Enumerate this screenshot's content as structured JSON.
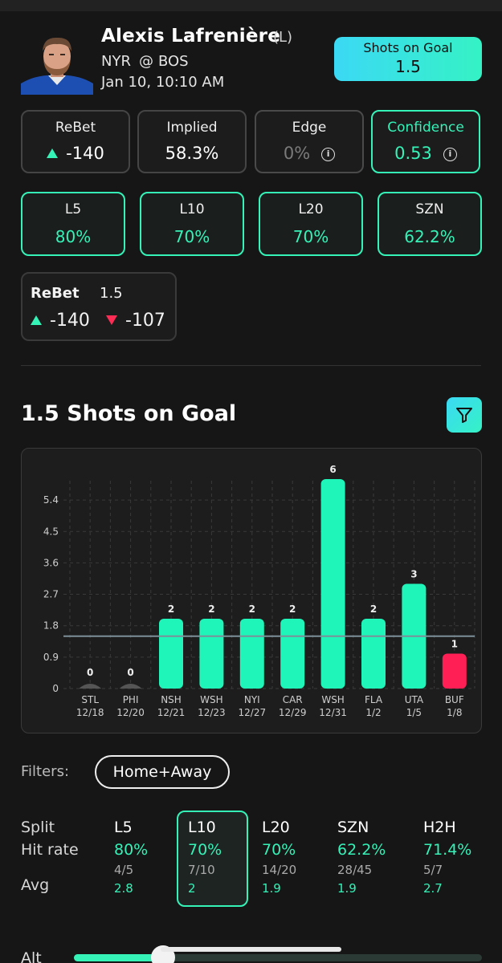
{
  "player": {
    "name": "Alexis Lafrenière",
    "position": "(L)",
    "team": "NYR",
    "at": "@",
    "opponent": "BOS",
    "datetime": "Jan 10, 10:10 AM"
  },
  "prop": {
    "label": "Shots on Goal",
    "line": "1.5"
  },
  "stats": {
    "rebet": {
      "title": "ReBet",
      "value": "-140"
    },
    "implied": {
      "title": "Implied",
      "value": "58.3%"
    },
    "edge": {
      "title": "Edge",
      "value": "0%"
    },
    "confidence": {
      "title": "Confidence",
      "value": "0.53"
    }
  },
  "hit_boxes": [
    {
      "title": "L5",
      "value": "80%"
    },
    {
      "title": "L10",
      "value": "70%"
    },
    {
      "title": "L20",
      "value": "70%"
    },
    {
      "title": "SZN",
      "value": "62.2%"
    }
  ],
  "odds": {
    "book": "ReBet",
    "line": "1.5",
    "over": "-140",
    "under": "-107"
  },
  "section": {
    "title": "1.5 Shots on Goal"
  },
  "chart_data": {
    "type": "bar",
    "categories": [
      "STL",
      "PHI",
      "NSH",
      "WSH",
      "NYI",
      "CAR",
      "WSH",
      "FLA",
      "UTA",
      "BUF"
    ],
    "dates": [
      "12/18",
      "12/20",
      "12/21",
      "12/23",
      "12/27",
      "12/29",
      "12/31",
      "1/2",
      "1/5",
      "1/8"
    ],
    "values": [
      0,
      0,
      2,
      2,
      2,
      2,
      6,
      2,
      3,
      1
    ],
    "yticks": [
      0,
      0.9,
      1.8,
      2.7,
      3.6,
      4.5,
      5.4
    ],
    "ylim": [
      0,
      6
    ],
    "reference_line": 1.5,
    "colors": {
      "hit": "#1ff5b8",
      "miss": "#ff1f55",
      "zero": "#555555"
    }
  },
  "filters": {
    "label": "Filters:",
    "value": "Home+Away"
  },
  "split": {
    "labels": {
      "split": "Split",
      "hit_rate": "Hit rate",
      "avg": "Avg"
    },
    "columns": [
      {
        "header": "L5",
        "rate": "80%",
        "fraction": "4/5",
        "avg": "2.8"
      },
      {
        "header": "L10",
        "rate": "70%",
        "fraction": "7/10",
        "avg": "2"
      },
      {
        "header": "L20",
        "rate": "70%",
        "fraction": "14/20",
        "avg": "1.9"
      },
      {
        "header": "SZN",
        "rate": "62.2%",
        "fraction": "28/45",
        "avg": "1.9"
      },
      {
        "header": "H2H",
        "rate": "71.4%",
        "fraction": "5/7",
        "avg": "2.7"
      }
    ]
  },
  "alt": {
    "label": "Alt"
  }
}
